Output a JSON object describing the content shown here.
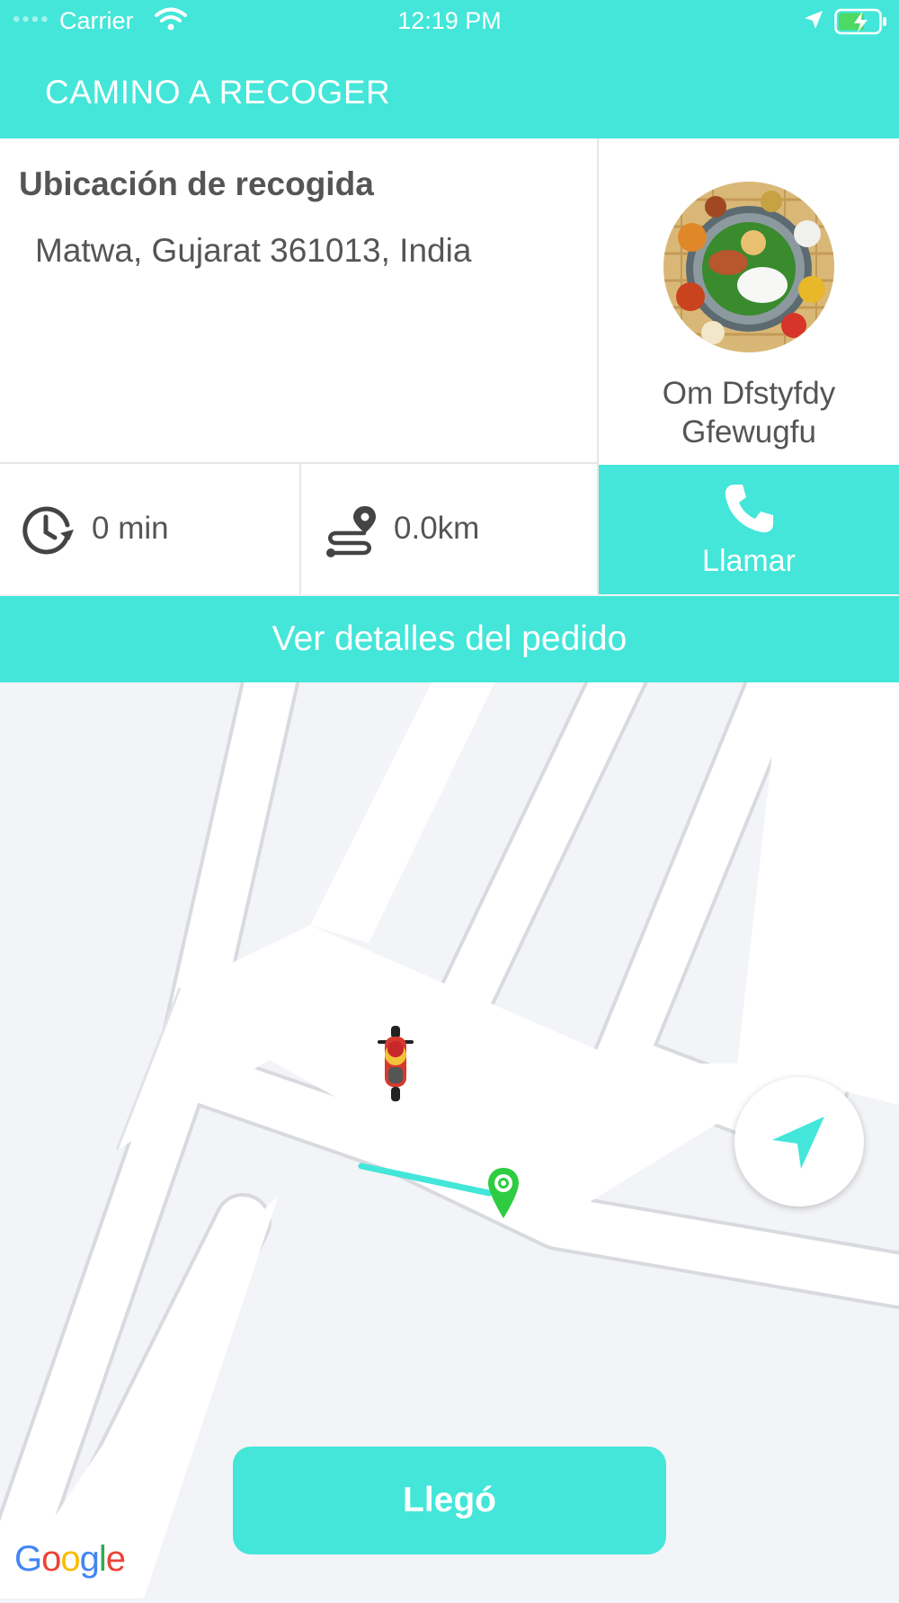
{
  "status_bar": {
    "signal_dots": "••••",
    "carrier": "Carrier",
    "time": "12:19 PM"
  },
  "header": {
    "title": "CAMINO A RECOGER"
  },
  "pickup": {
    "label": "Ubicación de recogida",
    "address": "Matwa, Gujarat 361013, India"
  },
  "customer": {
    "name": "Om Dfstyfdy Gfewugfu",
    "avatar_icon": "food-thali-avatar"
  },
  "stats": {
    "time_value": "0 min",
    "time_icon": "clock-icon",
    "distance_value": "0.0km",
    "distance_icon": "route-icon"
  },
  "call": {
    "label": "Llamar",
    "icon": "phone-icon"
  },
  "order_details": {
    "label": "Ver detalles del pedido"
  },
  "map": {
    "driver_icon": "motorbike-icon",
    "destination_icon": "map-pin-icon",
    "recenter_icon": "navigation-arrow-icon",
    "route_color": "#43e6d9",
    "destination_color": "#2ecc40"
  },
  "arrive_button": {
    "label": "Llegó"
  },
  "attribution": {
    "g1": "G",
    "o1": "o",
    "o2": "o",
    "g2": "g",
    "l": "l",
    "e": "e"
  },
  "colors": {
    "accent": "#43e6d9",
    "text": "#555555",
    "map_background": "#f3f4f7"
  }
}
